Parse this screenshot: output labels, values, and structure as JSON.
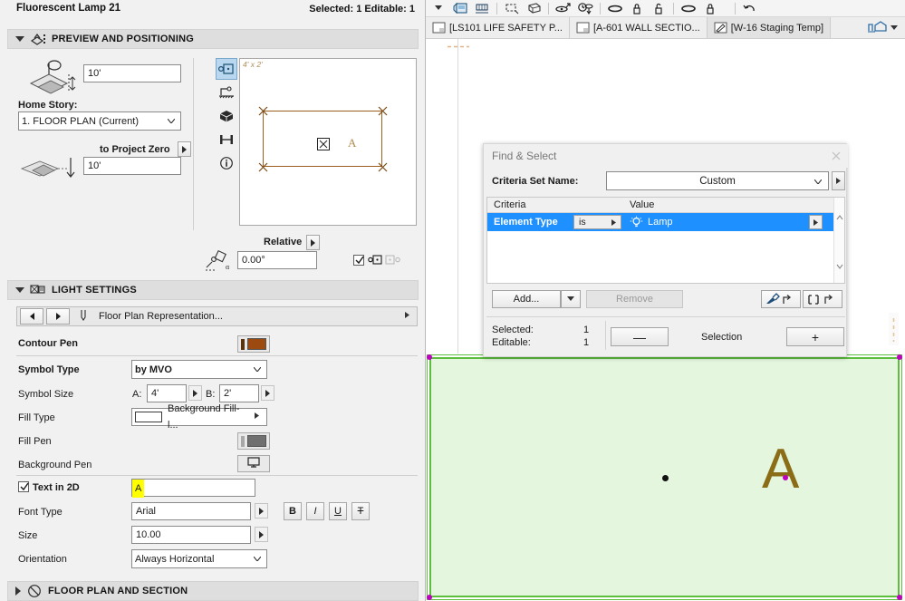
{
  "object_panel": {
    "title": "Fluorescent Lamp 21",
    "selection_status": "Selected: 1 Editable: 1",
    "sections": {
      "preview": {
        "label": "PREVIEW AND POSITIONING",
        "icon": "preview-positioning-icon",
        "expanded": true,
        "elevation_value": "10'",
        "home_story_label": "Home Story:",
        "home_story_value": "1. FLOOR PLAN (Current)",
        "to_project_zero_label": "to Project Zero",
        "project_zero_value": "10'",
        "relative_label": "Relative",
        "angle_value": "0.00°",
        "preview_dims": "4' x 2'",
        "preview_symbol_letter": "A",
        "rail_icons": [
          "plan-symbol-view-icon",
          "elevation-view-icon",
          "3d-view-icon",
          "section-view-icon",
          "info-icon"
        ]
      },
      "light_settings": {
        "label": "LIGHT SETTINGS",
        "icon": "light-settings-icon",
        "expanded": true,
        "page_nav_label": "Floor Plan Representation...",
        "rows": {
          "contour_pen": {
            "label": "Contour Pen",
            "color": "#9c4a0f"
          },
          "symbol_type": {
            "label": "Symbol Type",
            "value": "by MVO"
          },
          "symbol_size": {
            "label": "Symbol Size",
            "a_label": "A:",
            "a_value": "4'",
            "b_label": "B:",
            "b_value": "2'"
          },
          "fill_type": {
            "label": "Fill Type",
            "value": "Background Fill-l..."
          },
          "fill_pen": {
            "label": "Fill Pen",
            "color": "#707070"
          },
          "background_pen": {
            "label": "Background Pen",
            "icon": "screen-pen-icon"
          },
          "text_in_2d": {
            "label": "Text in 2D",
            "checked": true,
            "value": "A"
          },
          "font_type": {
            "label": "Font Type",
            "value": "Arial"
          },
          "size": {
            "label": "Size",
            "value": "10.00"
          },
          "orientation": {
            "label": "Orientation",
            "value": "Always Horizontal"
          }
        },
        "format_buttons": [
          {
            "name": "bold-button",
            "label": "B"
          },
          {
            "name": "italic-button",
            "label": "I"
          },
          {
            "name": "underline-button",
            "label": "U"
          },
          {
            "name": "strikethrough-button",
            "label": "T"
          }
        ]
      },
      "floor_plan_section": {
        "label": "FLOOR PLAN AND SECTION",
        "icon": "floor-plan-section-icon",
        "expanded": false
      }
    }
  },
  "toolbar": {
    "icons": [
      "publisher-icon",
      "trace-reference-icon",
      "marquee-icon",
      "3d-cutaway-icon",
      "pet-palette-icon",
      "time-edit-icon",
      "ellipse-icon",
      "lock-icon",
      "unlock-icon",
      "ellipse-2-icon",
      "lock-2-icon",
      "undo-icon"
    ]
  },
  "tabs": [
    {
      "label": "[LS101 LIFE SAFETY P...",
      "icon": "layout-icon",
      "active": false
    },
    {
      "label": "[A-601 WALL SECTIO...",
      "icon": "layout-icon",
      "active": false
    },
    {
      "label": "[W-16 Staging Temp]",
      "icon": "worksheet-icon",
      "active": true
    }
  ],
  "tab_right": {
    "icon": "3d-window-icon",
    "chevron": "chevron-down-icon"
  },
  "find_select": {
    "title": "Find & Select",
    "close_icon": "close-icon",
    "criteria_set_label": "Criteria Set Name:",
    "criteria_set_value": "Custom",
    "table": {
      "headers": [
        "Criteria",
        "Value"
      ],
      "rows": [
        {
          "criteria": "Element Type",
          "operator": "is",
          "value": "Lamp",
          "value_icon": "lamp-icon",
          "selected": true
        }
      ]
    },
    "buttons": {
      "add": "Add...",
      "remove": "Remove",
      "pick_tool_icon": "eyedropper-icon",
      "inject_tool_icon": "marquee-transfer-icon"
    },
    "status": {
      "selected_label": "Selected:",
      "selected_value": "1",
      "editable_label": "Editable:",
      "editable_value": "1",
      "minus_label": "—",
      "selection_label": "Selection",
      "plus_label": "+"
    }
  },
  "canvas": {
    "symbol_letter": "A",
    "region_fill": "#e4f7de",
    "region_stroke": "#5bbf3d",
    "node_color": "#c000c0"
  }
}
